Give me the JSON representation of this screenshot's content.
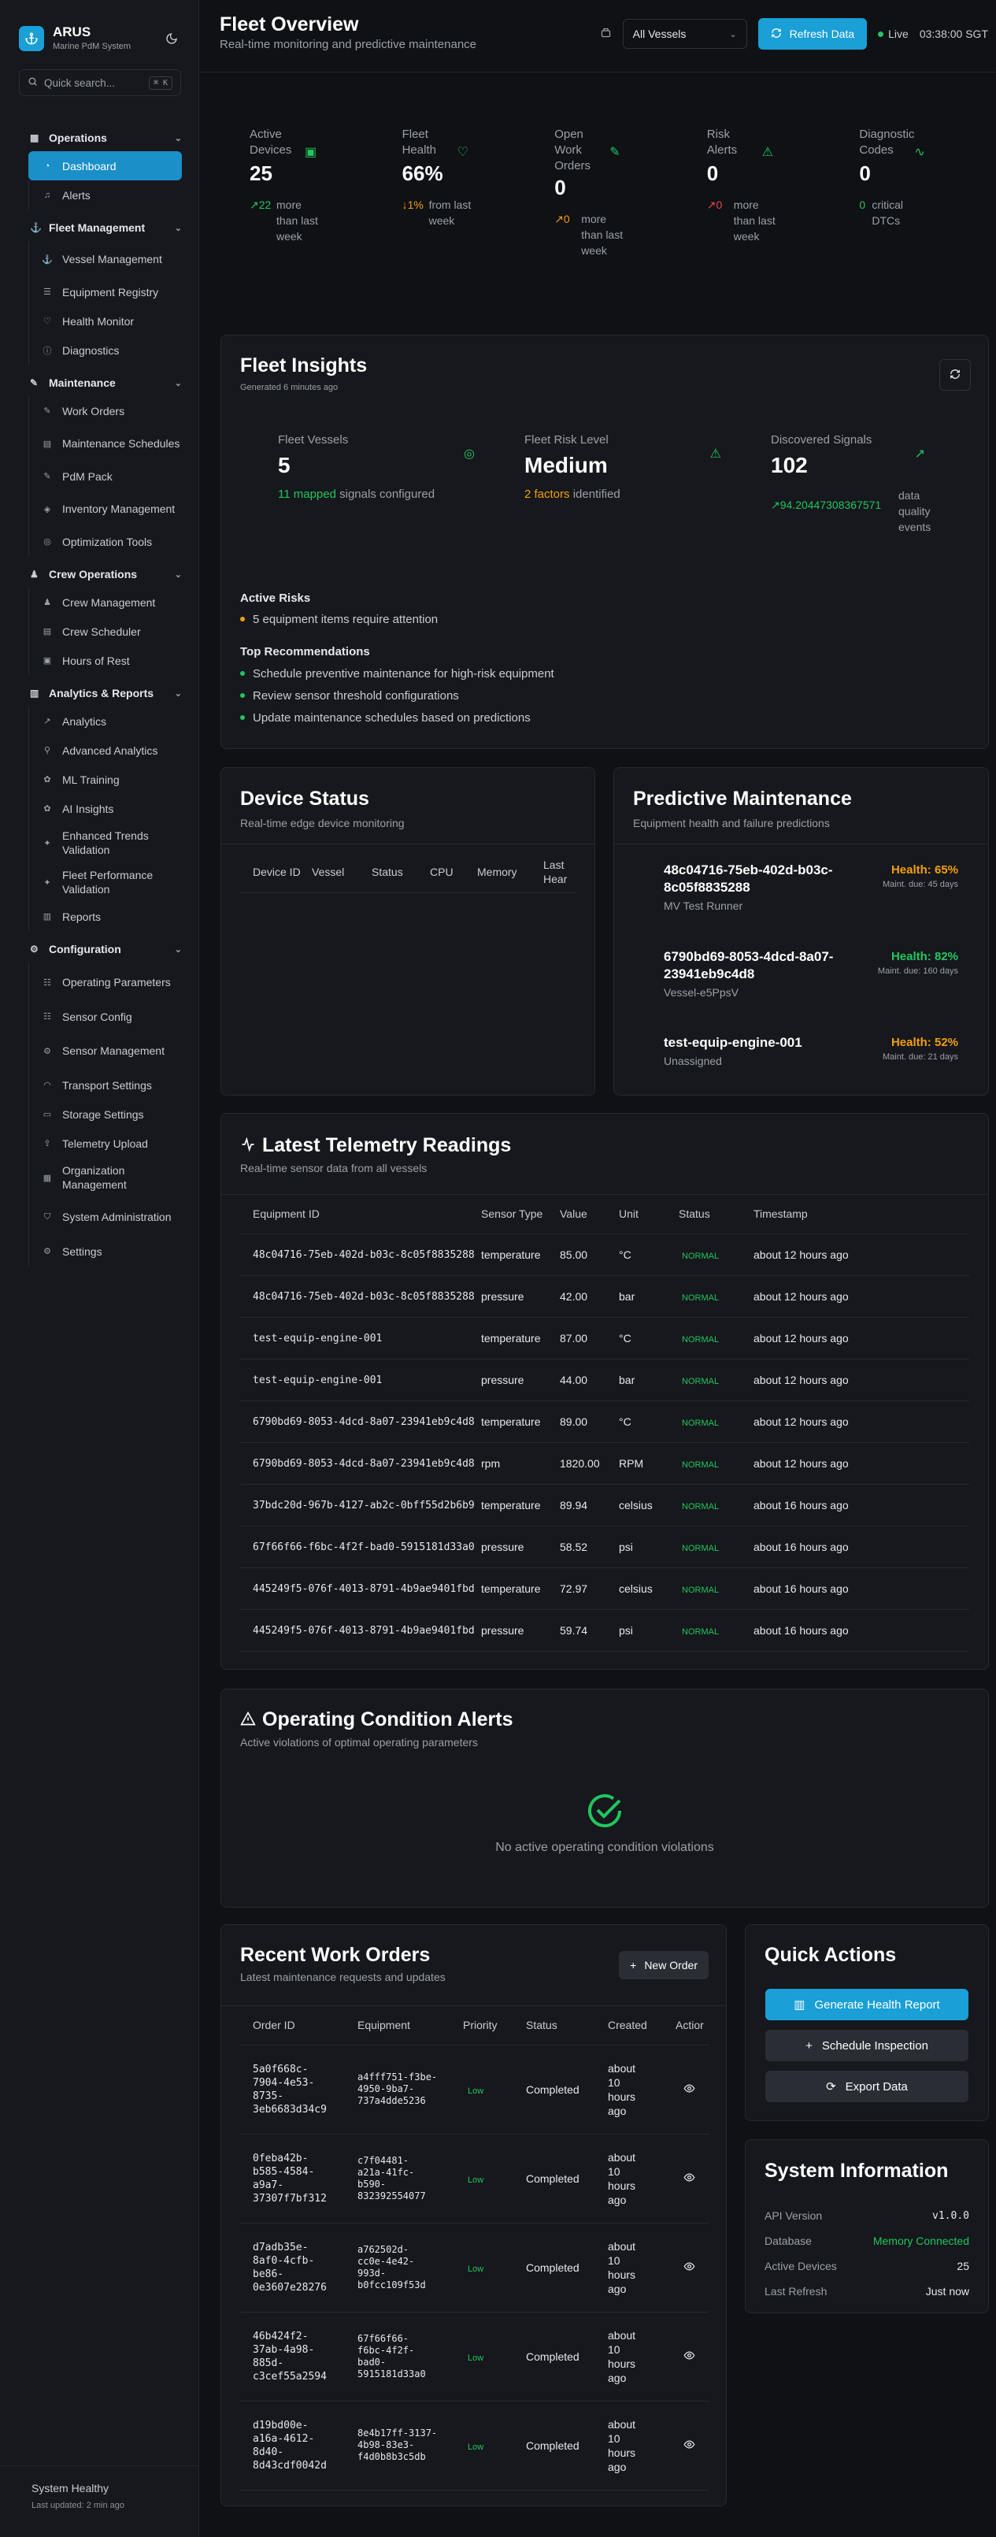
{
  "app": {
    "name": "ARUS",
    "subtitle": "Marine PdM System"
  },
  "search": {
    "placeholder": "Quick search...",
    "shortcut": "⌘ K"
  },
  "nav": {
    "operations": {
      "label": "Operations",
      "items": [
        {
          "label": "Dashboard"
        },
        {
          "label": "Alerts"
        }
      ]
    },
    "fleet": {
      "label": "Fleet Management",
      "items": [
        {
          "label": "Vessel Management"
        },
        {
          "label": "Equipment Registry"
        },
        {
          "label": "Health Monitor"
        },
        {
          "label": "Diagnostics"
        }
      ]
    },
    "maintenance": {
      "label": "Maintenance",
      "items": [
        {
          "label": "Work Orders"
        },
        {
          "label": "Maintenance Schedules"
        },
        {
          "label": "PdM Pack"
        },
        {
          "label": "Inventory Management"
        },
        {
          "label": "Optimization Tools"
        }
      ]
    },
    "crew": {
      "label": "Crew Operations",
      "items": [
        {
          "label": "Crew Management"
        },
        {
          "label": "Crew Scheduler"
        },
        {
          "label": "Hours of Rest"
        }
      ]
    },
    "analytics": {
      "label": "Analytics & Reports",
      "items": [
        {
          "label": "Analytics"
        },
        {
          "label": "Advanced Analytics"
        },
        {
          "label": "ML Training"
        },
        {
          "label": "AI Insights"
        },
        {
          "label": "Enhanced Trends Validation"
        },
        {
          "label": "Fleet Performance Validation"
        },
        {
          "label": "Reports"
        }
      ]
    },
    "config": {
      "label": "Configuration",
      "items": [
        {
          "label": "Operating Parameters"
        },
        {
          "label": "Sensor Config"
        },
        {
          "label": "Sensor Management"
        },
        {
          "label": "Transport Settings"
        },
        {
          "label": "Storage Settings"
        },
        {
          "label": "Telemetry Upload"
        },
        {
          "label": "Organization Management"
        },
        {
          "label": "System Administration"
        },
        {
          "label": "Settings"
        }
      ]
    }
  },
  "sidebar_footer": {
    "status": "System Healthy",
    "updated": "Last updated: 2 min ago"
  },
  "header": {
    "title": "Fleet Overview",
    "subtitle": "Real-time monitoring and predictive maintenance",
    "vessel_select": "All Vessels",
    "refresh_label": "Refresh Data",
    "live_label": "Live",
    "time": "03:38:00 SGT"
  },
  "stats": [
    {
      "label": "Active Devices",
      "value": "25",
      "change": "↗22",
      "desc": "more than last week",
      "color": "#22c55e"
    },
    {
      "label": "Fleet Health",
      "value": "66%",
      "change": "↓1%",
      "desc": "from last week",
      "color": "#f59e0b"
    },
    {
      "label": "Open Work Orders",
      "value": "0",
      "change": "↗0",
      "desc": "more than last week",
      "color": "#f59e0b"
    },
    {
      "label": "Risk Alerts",
      "value": "0",
      "change": "↗0",
      "desc": "more than last week",
      "color": "#ef4444"
    },
    {
      "label": "Diagnostic Codes",
      "value": "0",
      "change": "0",
      "desc": "critical DTCs",
      "color": "#22c55e"
    }
  ],
  "insights": {
    "title": "Fleet Insights",
    "generated": "Generated 6 minutes ago",
    "vessels": {
      "label": "Fleet Vessels",
      "value": "5",
      "highlight": "11 mapped",
      "rest": "signals configured"
    },
    "risk": {
      "label": "Fleet Risk Level",
      "value": "Medium",
      "highlight": "2 factors",
      "rest": "identified"
    },
    "signals": {
      "label": "Discovered Signals",
      "value": "102",
      "highlight": "↗94.20447308367571",
      "rest": "data quality events"
    },
    "active_risks_title": "Active Risks",
    "active_risks": [
      "5 equipment items require attention"
    ],
    "recs_title": "Top Recommendations",
    "recs": [
      "Schedule preventive maintenance for high-risk equipment",
      "Review sensor threshold configurations",
      "Update maintenance schedules based on predictions"
    ]
  },
  "device_status": {
    "title": "Device Status",
    "subtitle": "Real-time edge device monitoring",
    "columns": [
      "Device ID",
      "Vessel",
      "Status",
      "CPU",
      "Memory",
      "Last Hear"
    ]
  },
  "predictive": {
    "title": "Predictive Maintenance",
    "subtitle": "Equipment health and failure predictions",
    "items": [
      {
        "id": "48c04716-75eb-402d-b03c-8c05f8835288",
        "vessel": "MV Test Runner",
        "health": "Health: 65%",
        "due": "Maint. due: 45 days",
        "color": "#f59e0b"
      },
      {
        "id": "6790bd69-8053-4dcd-8a07-23941eb9c4d8",
        "vessel": "Vessel-e5PpsV",
        "health": "Health: 82%",
        "due": "Maint. due: 160 days",
        "color": "#22c55e"
      },
      {
        "id": "test-equip-engine-001",
        "vessel": "Unassigned",
        "health": "Health: 52%",
        "due": "Maint. due: 21 days",
        "color": "#f59e0b"
      }
    ]
  },
  "telemetry": {
    "title": "Latest Telemetry Readings",
    "subtitle": "Real-time sensor data from all vessels",
    "columns": [
      "Equipment ID",
      "Sensor Type",
      "Value",
      "Unit",
      "Status",
      "Timestamp"
    ],
    "rows": [
      [
        "48c04716-75eb-402d-b03c-8c05f8835288",
        "temperature",
        "85.00",
        "°C",
        "NORMAL",
        "about 12 hours ago"
      ],
      [
        "48c04716-75eb-402d-b03c-8c05f8835288",
        "pressure",
        "42.00",
        "bar",
        "NORMAL",
        "about 12 hours ago"
      ],
      [
        "test-equip-engine-001",
        "temperature",
        "87.00",
        "°C",
        "NORMAL",
        "about 12 hours ago"
      ],
      [
        "test-equip-engine-001",
        "pressure",
        "44.00",
        "bar",
        "NORMAL",
        "about 12 hours ago"
      ],
      [
        "6790bd69-8053-4dcd-8a07-23941eb9c4d8",
        "temperature",
        "89.00",
        "°C",
        "NORMAL",
        "about 12 hours ago"
      ],
      [
        "6790bd69-8053-4dcd-8a07-23941eb9c4d8",
        "rpm",
        "1820.00",
        "RPM",
        "NORMAL",
        "about 12 hours ago"
      ],
      [
        "37bdc20d-967b-4127-ab2c-0bff55d2b6b9",
        "temperature",
        "89.94",
        "celsius",
        "NORMAL",
        "about 16 hours ago"
      ],
      [
        "67f66f66-f6bc-4f2f-bad0-5915181d33a0",
        "pressure",
        "58.52",
        "psi",
        "NORMAL",
        "about 16 hours ago"
      ],
      [
        "445249f5-076f-4013-8791-4b9ae9401fbd",
        "temperature",
        "72.97",
        "celsius",
        "NORMAL",
        "about 16 hours ago"
      ],
      [
        "445249f5-076f-4013-8791-4b9ae9401fbd",
        "pressure",
        "59.74",
        "psi",
        "NORMAL",
        "about 16 hours ago"
      ]
    ]
  },
  "alerts": {
    "title": "Operating Condition Alerts",
    "subtitle": "Active violations of optimal operating parameters",
    "empty": "No active operating condition violations"
  },
  "work_orders": {
    "title": "Recent Work Orders",
    "subtitle": "Latest maintenance requests and updates",
    "new_label": "New Order",
    "columns": [
      "Order ID",
      "Equipment",
      "Priority",
      "Status",
      "Created",
      "Actior"
    ],
    "rows": [
      {
        "id": [
          "5a0f668c-",
          "7904-4e53-",
          "8735-",
          "3eb6683d34c9"
        ],
        "equip": [
          "a4fff751-f3be-",
          "4950-9ba7-",
          "737a4dde5236"
        ],
        "priority": "Low",
        "status": "Completed",
        "created": [
          "about",
          "10",
          "hours",
          "ago"
        ]
      },
      {
        "id": [
          "0feba42b-",
          "b585-4584-",
          "a9a7-",
          "37307f7bf312"
        ],
        "equip": [
          "c7f04481-",
          "a21a-41fc-",
          "b590-",
          "832392554077"
        ],
        "priority": "Low",
        "status": "Completed",
        "created": [
          "about",
          "10",
          "hours",
          "ago"
        ]
      },
      {
        "id": [
          "d7adb35e-",
          "8af0-4cfb-",
          "be86-",
          "0e3607e28276"
        ],
        "equip": [
          "a762502d-",
          "cc0e-4e42-",
          "993d-",
          "b0fcc109f53d"
        ],
        "priority": "Low",
        "status": "Completed",
        "created": [
          "about",
          "10",
          "hours",
          "ago"
        ]
      },
      {
        "id": [
          "46b424f2-",
          "37ab-4a98-",
          "885d-",
          "c3cef55a2594"
        ],
        "equip": [
          "67f66f66-",
          "f6bc-4f2f-",
          "bad0-",
          "5915181d33a0"
        ],
        "priority": "Low",
        "status": "Completed",
        "created": [
          "about",
          "10",
          "hours",
          "ago"
        ]
      },
      {
        "id": [
          "d19bd00e-",
          "a16a-4612-",
          "8d40-",
          "8d43cdf0042d"
        ],
        "equip": [
          "8e4b17ff-3137-",
          "4b98-83e3-",
          "f4d0b8b3c5db"
        ],
        "priority": "Low",
        "status": "Completed",
        "created": [
          "about",
          "10",
          "hours",
          "ago"
        ]
      }
    ]
  },
  "quick_actions": {
    "title": "Quick Actions",
    "health_report": "Generate Health Report",
    "inspection": "Schedule Inspection",
    "export": "Export Data"
  },
  "system_info": {
    "title": "System Information",
    "rows": [
      {
        "label": "API Version",
        "value": "v1.0.0"
      },
      {
        "label": "Database",
        "value": "Memory Connected"
      },
      {
        "label": "Active Devices",
        "value": "25"
      },
      {
        "label": "Last Refresh",
        "value": "Just now"
      }
    ]
  }
}
